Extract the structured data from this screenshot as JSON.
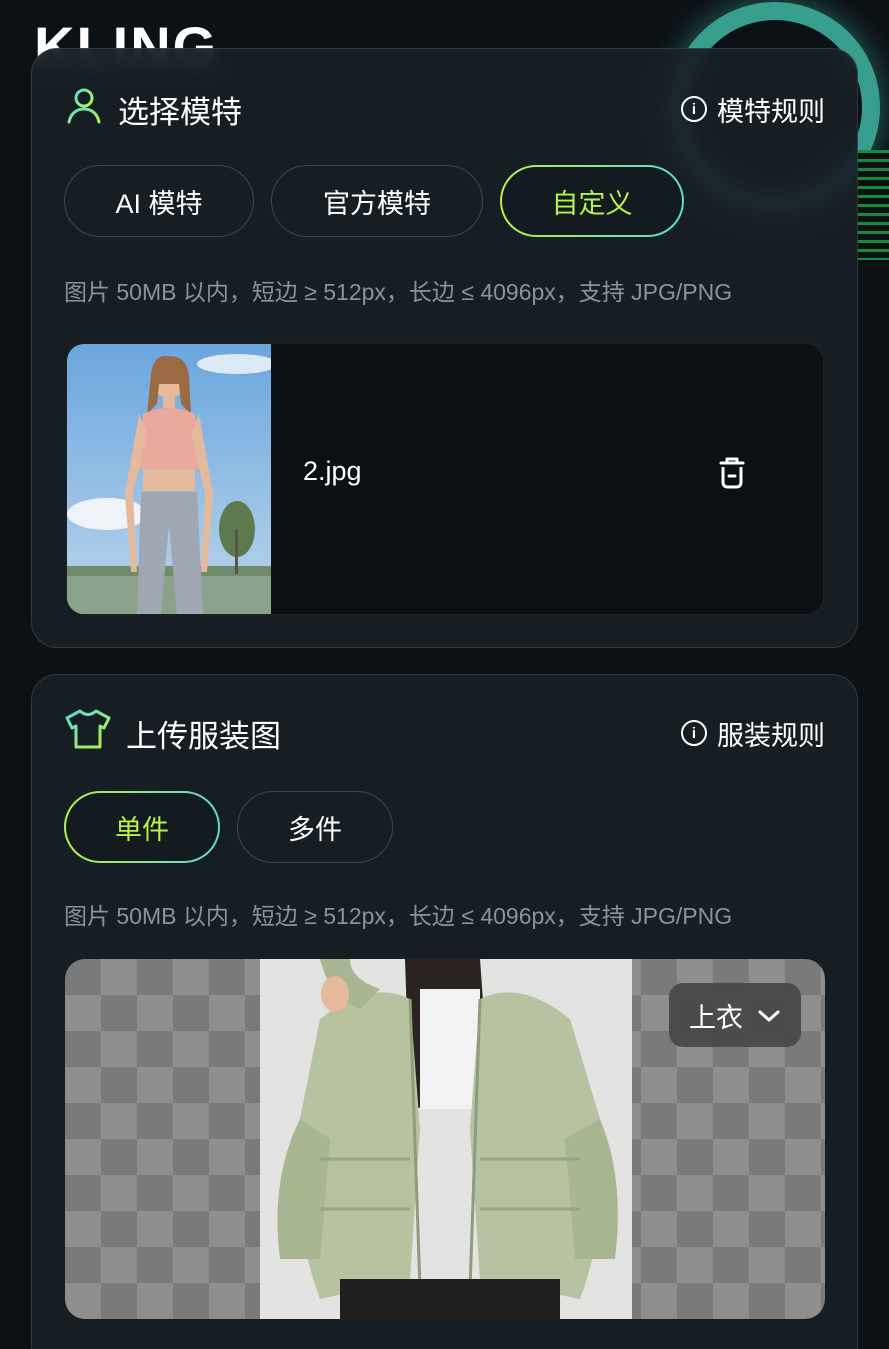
{
  "background": {
    "logo_text": "KLING"
  },
  "model_section": {
    "title": "选择模特",
    "rules_label": "模特规则",
    "tabs": [
      {
        "label": "AI 模特",
        "active": false
      },
      {
        "label": "官方模特",
        "active": false
      },
      {
        "label": "自定义",
        "active": true
      }
    ],
    "hint": "图片 50MB 以内，短边 ≥ 512px，长边 ≤ 4096px，支持 JPG/PNG",
    "uploaded_file": {
      "name": "2.jpg"
    }
  },
  "garment_section": {
    "title": "上传服装图",
    "rules_label": "服装规则",
    "tabs": [
      {
        "label": "单件",
        "active": true
      },
      {
        "label": "多件",
        "active": false
      }
    ],
    "hint": "图片 50MB 以内，短边 ≥ 512px，长边 ≤ 4096px，支持 JPG/PNG",
    "category": "上衣"
  },
  "colors": {
    "accent_green": "#b6f24a",
    "accent_cyan": "#5fd9d2",
    "card_bg": "#182026"
  }
}
